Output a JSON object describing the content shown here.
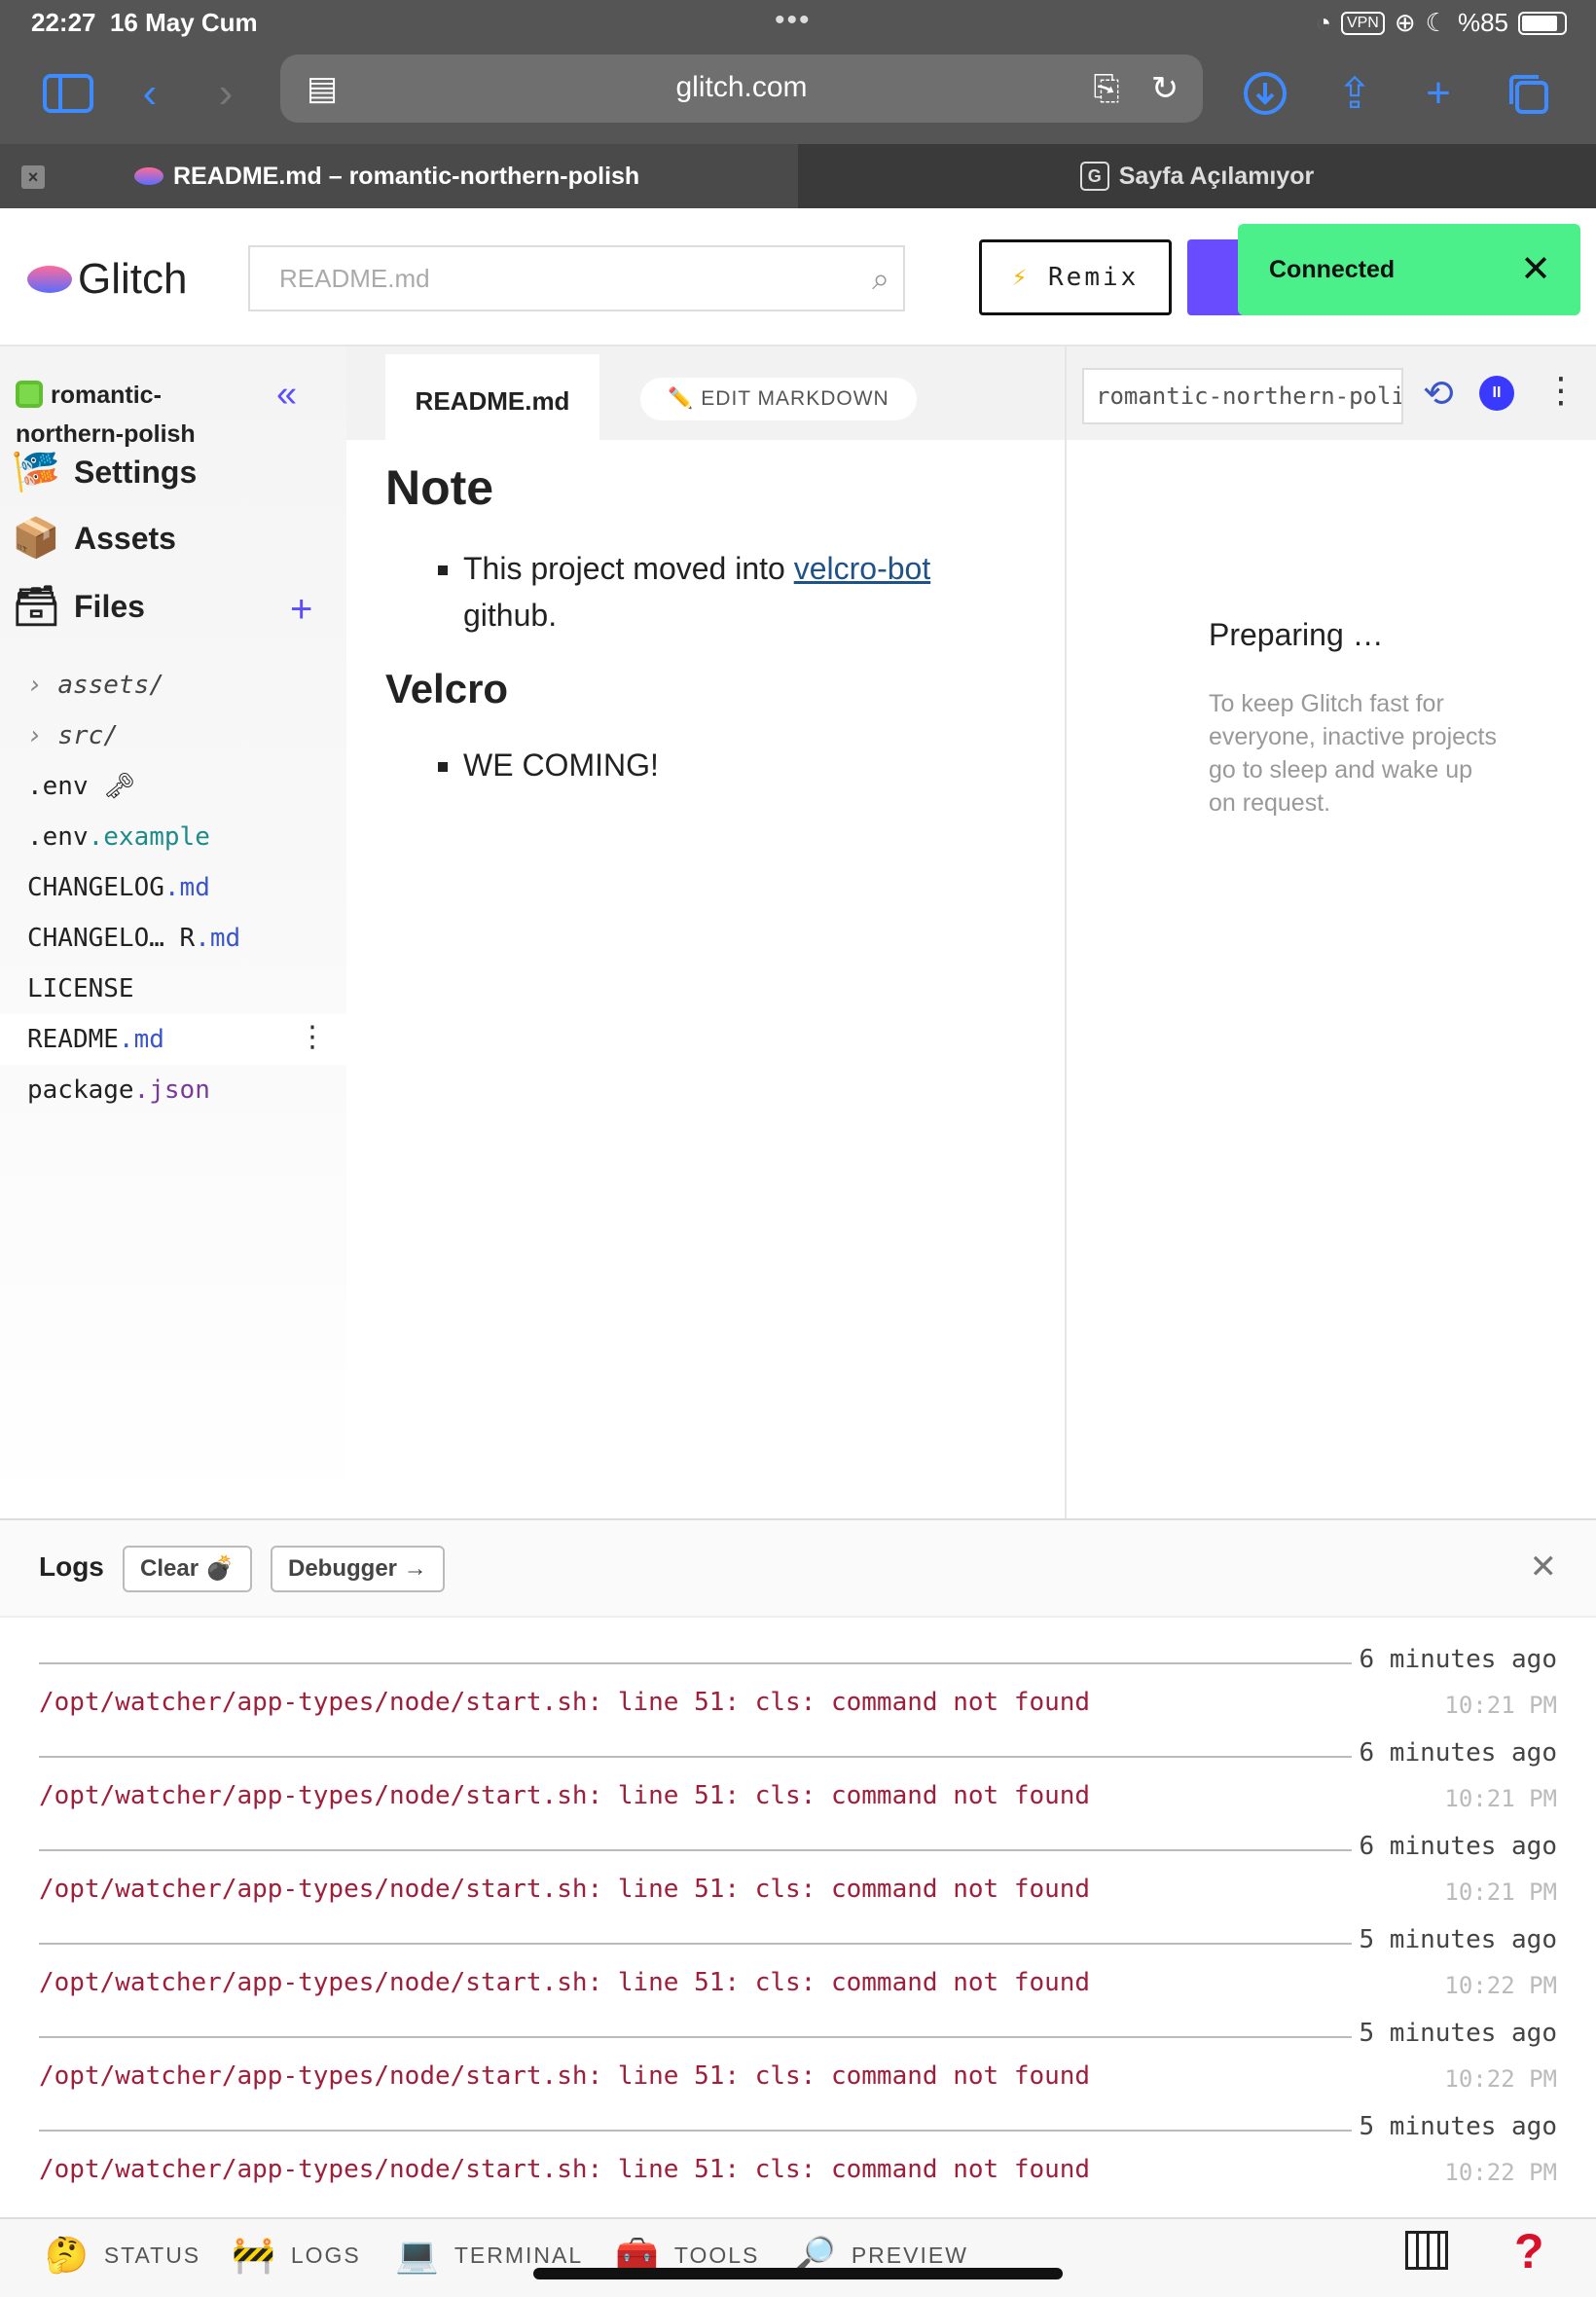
{
  "status_bar": {
    "time": "22:27",
    "date": "16 May Cum",
    "vpn": "VPN",
    "battery": "%85",
    "battery_level": 0.85
  },
  "browser": {
    "url": "glitch.com",
    "tabs": [
      {
        "title": "README.md – romantic-northern-polish"
      },
      {
        "title": "Sayfa Açılamıyor",
        "icon_letter": "G"
      }
    ]
  },
  "header": {
    "logo": "Glitch",
    "search_placeholder": "README.md",
    "remix_label": "Remix",
    "toast": "Connected"
  },
  "sidebar": {
    "project_line1": "romantic-",
    "project_line2": "northern-polish",
    "nav": [
      "Settings",
      "Assets",
      "Files"
    ],
    "files": [
      {
        "name": "assets/",
        "ext": ""
      },
      {
        "name": "src/",
        "ext": ""
      },
      {
        "name": ".env",
        "ext": ""
      },
      {
        "name": ".env",
        "ext": ".example"
      },
      {
        "name": "CHANGELOG",
        "ext": ".md"
      },
      {
        "name": "CHANGELO… R",
        "ext": ".md"
      },
      {
        "name": "LICENSE",
        "ext": ""
      },
      {
        "name": "README",
        "ext": ".md"
      },
      {
        "name": "package",
        "ext": ".json"
      }
    ]
  },
  "editor": {
    "tab": "README.md",
    "edit_button": "EDIT MARKDOWN",
    "h1": "Note",
    "item1_text": "This project moved into ",
    "item1_link": "velcro-bot",
    "item1_tail": "github.",
    "h2": "Velcro",
    "item2": "WE COMING!"
  },
  "preview": {
    "url": "romantic-northern-polish",
    "title": "Preparing …",
    "note": "To keep Glitch fast for everyone, inactive projects go to sleep and wake up on request."
  },
  "logs": {
    "title": "Logs",
    "clear": "Clear",
    "debugger": "Debugger →",
    "entries": [
      {
        "ago": "6 minutes ago",
        "msg": "/opt/watcher/app-types/node/start.sh: line 51: cls: command not found",
        "time": "10:21 PM"
      },
      {
        "ago": "6 minutes ago",
        "msg": "/opt/watcher/app-types/node/start.sh: line 51: cls: command not found",
        "time": "10:21 PM"
      },
      {
        "ago": "6 minutes ago",
        "msg": "/opt/watcher/app-types/node/start.sh: line 51: cls: command not found",
        "time": "10:21 PM"
      },
      {
        "ago": "5 minutes ago",
        "msg": "/opt/watcher/app-types/node/start.sh: line 51: cls: command not found",
        "time": "10:22 PM"
      },
      {
        "ago": "5 minutes ago",
        "msg": "/opt/watcher/app-types/node/start.sh: line 51: cls: command not found",
        "time": "10:22 PM"
      },
      {
        "ago": "5 minutes ago",
        "msg": "/opt/watcher/app-types/node/start.sh: line 51: cls: command not found",
        "time": "10:22 PM"
      }
    ]
  },
  "bottom_bar": [
    "STATUS",
    "LOGS",
    "TERMINAL",
    "TOOLS",
    "PREVIEW"
  ],
  "help": "?"
}
